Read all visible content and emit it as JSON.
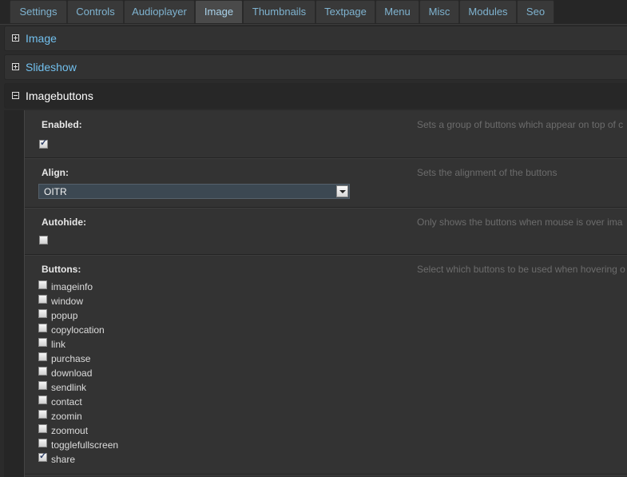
{
  "tabs": [
    {
      "label": "Settings",
      "active": false
    },
    {
      "label": "Controls",
      "active": false
    },
    {
      "label": "Audioplayer",
      "active": false
    },
    {
      "label": "Image",
      "active": true
    },
    {
      "label": "Thumbnails",
      "active": false
    },
    {
      "label": "Textpage",
      "active": false
    },
    {
      "label": "Menu",
      "active": false
    },
    {
      "label": "Misc",
      "active": false
    },
    {
      "label": "Modules",
      "active": false
    },
    {
      "label": "Seo",
      "active": false
    }
  ],
  "sections": [
    {
      "label": "Image",
      "expanded": false
    },
    {
      "label": "Slideshow",
      "expanded": false
    },
    {
      "label": "Imagebuttons",
      "expanded": true
    }
  ],
  "settings": {
    "enabled": {
      "label": "Enabled:",
      "checked": true,
      "description": "Sets a group of buttons which appear on top of c"
    },
    "align": {
      "label": "Align:",
      "value": "OITR",
      "description": "Sets the alignment of the buttons"
    },
    "autohide": {
      "label": "Autohide:",
      "checked": false,
      "description": "Only shows the buttons when mouse is over ima"
    },
    "buttons": {
      "label": "Buttons:",
      "description": "Select which buttons to be used when hovering o",
      "options": [
        {
          "label": "imageinfo",
          "checked": false
        },
        {
          "label": "window",
          "checked": false
        },
        {
          "label": "popup",
          "checked": false
        },
        {
          "label": "copylocation",
          "checked": false
        },
        {
          "label": "link",
          "checked": false
        },
        {
          "label": "purchase",
          "checked": false
        },
        {
          "label": "download",
          "checked": false
        },
        {
          "label": "sendlink",
          "checked": false
        },
        {
          "label": "contact",
          "checked": false
        },
        {
          "label": "zoomin",
          "checked": false
        },
        {
          "label": "zoomout",
          "checked": false
        },
        {
          "label": "togglefullscreen",
          "checked": false
        },
        {
          "label": "share",
          "checked": true
        }
      ]
    }
  },
  "colors": {
    "accent": "#72c0ee",
    "background": "#333333",
    "tab": "#393939",
    "active_tab": "#4a4a4a"
  }
}
